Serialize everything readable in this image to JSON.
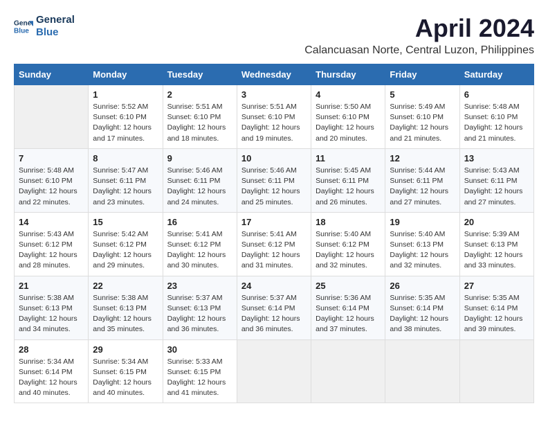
{
  "logo": {
    "line1": "General",
    "line2": "Blue"
  },
  "title": "April 2024",
  "subtitle": "Calancuasan Norte, Central Luzon, Philippines",
  "weekdays": [
    "Sunday",
    "Monday",
    "Tuesday",
    "Wednesday",
    "Thursday",
    "Friday",
    "Saturday"
  ],
  "weeks": [
    [
      {
        "day": "",
        "info": ""
      },
      {
        "day": "1",
        "info": "Sunrise: 5:52 AM\nSunset: 6:10 PM\nDaylight: 12 hours\nand 17 minutes."
      },
      {
        "day": "2",
        "info": "Sunrise: 5:51 AM\nSunset: 6:10 PM\nDaylight: 12 hours\nand 18 minutes."
      },
      {
        "day": "3",
        "info": "Sunrise: 5:51 AM\nSunset: 6:10 PM\nDaylight: 12 hours\nand 19 minutes."
      },
      {
        "day": "4",
        "info": "Sunrise: 5:50 AM\nSunset: 6:10 PM\nDaylight: 12 hours\nand 20 minutes."
      },
      {
        "day": "5",
        "info": "Sunrise: 5:49 AM\nSunset: 6:10 PM\nDaylight: 12 hours\nand 21 minutes."
      },
      {
        "day": "6",
        "info": "Sunrise: 5:48 AM\nSunset: 6:10 PM\nDaylight: 12 hours\nand 21 minutes."
      }
    ],
    [
      {
        "day": "7",
        "info": "Sunrise: 5:48 AM\nSunset: 6:10 PM\nDaylight: 12 hours\nand 22 minutes."
      },
      {
        "day": "8",
        "info": "Sunrise: 5:47 AM\nSunset: 6:11 PM\nDaylight: 12 hours\nand 23 minutes."
      },
      {
        "day": "9",
        "info": "Sunrise: 5:46 AM\nSunset: 6:11 PM\nDaylight: 12 hours\nand 24 minutes."
      },
      {
        "day": "10",
        "info": "Sunrise: 5:46 AM\nSunset: 6:11 PM\nDaylight: 12 hours\nand 25 minutes."
      },
      {
        "day": "11",
        "info": "Sunrise: 5:45 AM\nSunset: 6:11 PM\nDaylight: 12 hours\nand 26 minutes."
      },
      {
        "day": "12",
        "info": "Sunrise: 5:44 AM\nSunset: 6:11 PM\nDaylight: 12 hours\nand 27 minutes."
      },
      {
        "day": "13",
        "info": "Sunrise: 5:43 AM\nSunset: 6:11 PM\nDaylight: 12 hours\nand 27 minutes."
      }
    ],
    [
      {
        "day": "14",
        "info": "Sunrise: 5:43 AM\nSunset: 6:12 PM\nDaylight: 12 hours\nand 28 minutes."
      },
      {
        "day": "15",
        "info": "Sunrise: 5:42 AM\nSunset: 6:12 PM\nDaylight: 12 hours\nand 29 minutes."
      },
      {
        "day": "16",
        "info": "Sunrise: 5:41 AM\nSunset: 6:12 PM\nDaylight: 12 hours\nand 30 minutes."
      },
      {
        "day": "17",
        "info": "Sunrise: 5:41 AM\nSunset: 6:12 PM\nDaylight: 12 hours\nand 31 minutes."
      },
      {
        "day": "18",
        "info": "Sunrise: 5:40 AM\nSunset: 6:12 PM\nDaylight: 12 hours\nand 32 minutes."
      },
      {
        "day": "19",
        "info": "Sunrise: 5:40 AM\nSunset: 6:13 PM\nDaylight: 12 hours\nand 32 minutes."
      },
      {
        "day": "20",
        "info": "Sunrise: 5:39 AM\nSunset: 6:13 PM\nDaylight: 12 hours\nand 33 minutes."
      }
    ],
    [
      {
        "day": "21",
        "info": "Sunrise: 5:38 AM\nSunset: 6:13 PM\nDaylight: 12 hours\nand 34 minutes."
      },
      {
        "day": "22",
        "info": "Sunrise: 5:38 AM\nSunset: 6:13 PM\nDaylight: 12 hours\nand 35 minutes."
      },
      {
        "day": "23",
        "info": "Sunrise: 5:37 AM\nSunset: 6:13 PM\nDaylight: 12 hours\nand 36 minutes."
      },
      {
        "day": "24",
        "info": "Sunrise: 5:37 AM\nSunset: 6:14 PM\nDaylight: 12 hours\nand 36 minutes."
      },
      {
        "day": "25",
        "info": "Sunrise: 5:36 AM\nSunset: 6:14 PM\nDaylight: 12 hours\nand 37 minutes."
      },
      {
        "day": "26",
        "info": "Sunrise: 5:35 AM\nSunset: 6:14 PM\nDaylight: 12 hours\nand 38 minutes."
      },
      {
        "day": "27",
        "info": "Sunrise: 5:35 AM\nSunset: 6:14 PM\nDaylight: 12 hours\nand 39 minutes."
      }
    ],
    [
      {
        "day": "28",
        "info": "Sunrise: 5:34 AM\nSunset: 6:14 PM\nDaylight: 12 hours\nand 40 minutes."
      },
      {
        "day": "29",
        "info": "Sunrise: 5:34 AM\nSunset: 6:15 PM\nDaylight: 12 hours\nand 40 minutes."
      },
      {
        "day": "30",
        "info": "Sunrise: 5:33 AM\nSunset: 6:15 PM\nDaylight: 12 hours\nand 41 minutes."
      },
      {
        "day": "",
        "info": ""
      },
      {
        "day": "",
        "info": ""
      },
      {
        "day": "",
        "info": ""
      },
      {
        "day": "",
        "info": ""
      }
    ]
  ]
}
